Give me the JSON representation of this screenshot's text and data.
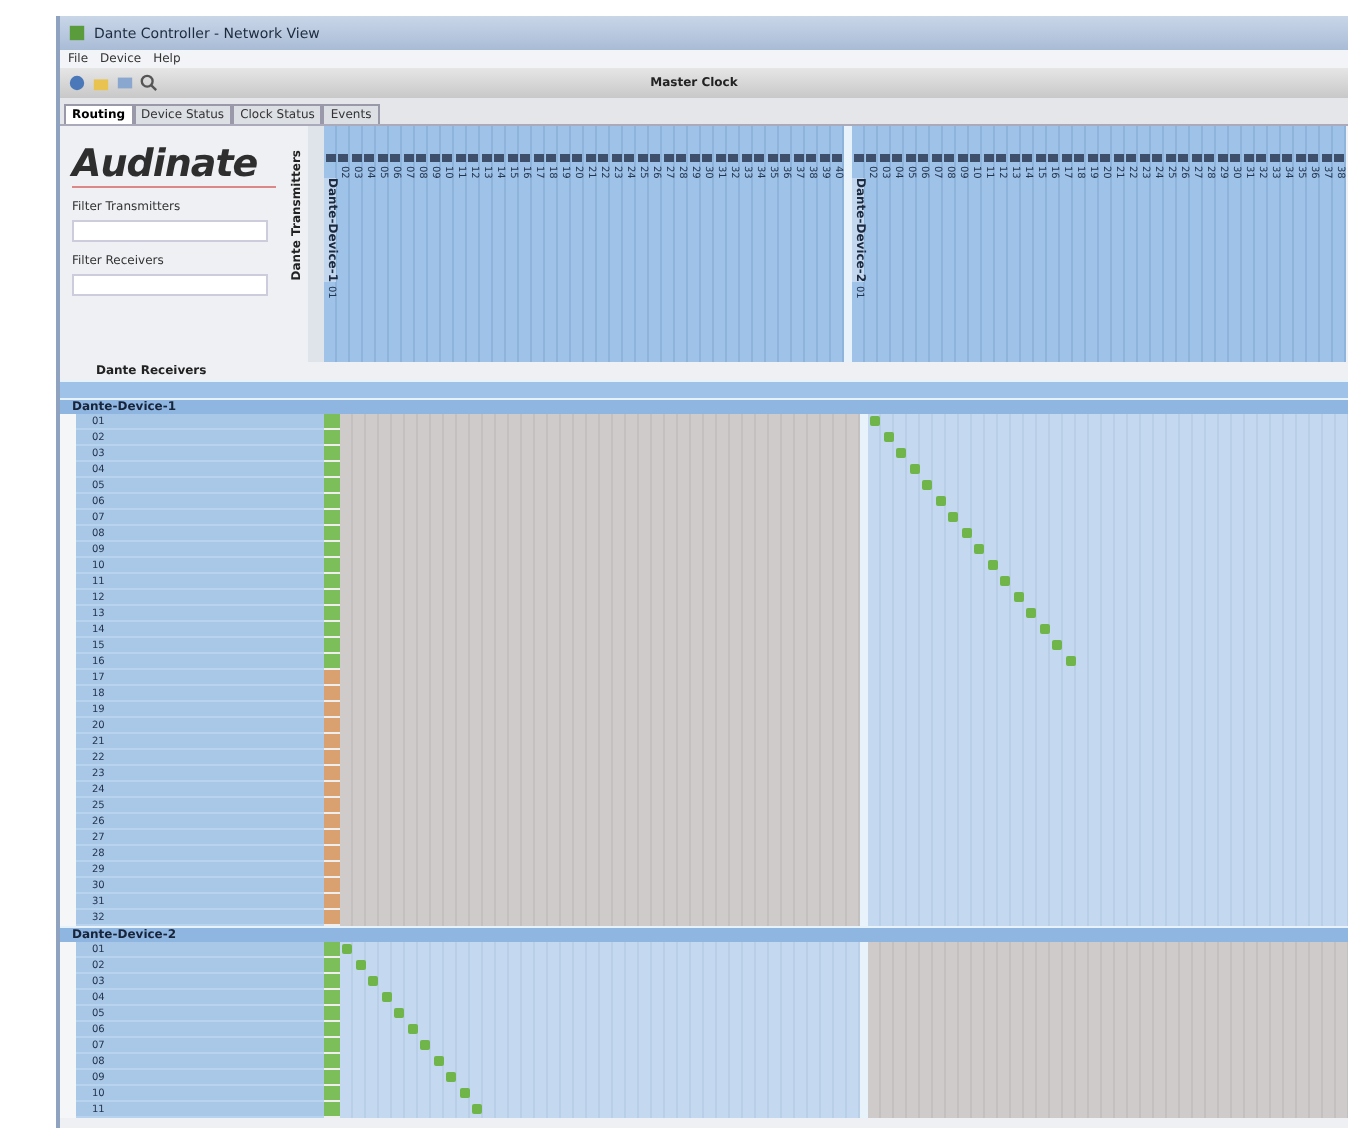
{
  "window": {
    "title": "Dante Controller - Network View"
  },
  "menu": [
    "File",
    "Device",
    "Help"
  ],
  "toolbar": {
    "status": "Master Clock"
  },
  "tabs": [
    {
      "label": "Routing",
      "selected": true
    },
    {
      "label": "Device Status",
      "selected": false
    },
    {
      "label": "Clock Status",
      "selected": false
    },
    {
      "label": "Events",
      "selected": false
    }
  ],
  "sidebar": {
    "logo": "Audinate",
    "filters": [
      {
        "label": "Filter Transmitters"
      },
      {
        "label": "Filter Receivers"
      }
    ],
    "transmitters_label": "Dante Transmitters",
    "receivers_label": "Dante Receivers"
  },
  "transmitters": [
    {
      "name": "Dante-Device-1",
      "channels": [
        "01",
        "02",
        "03",
        "04",
        "05",
        "06",
        "07",
        "08",
        "09",
        "10",
        "11",
        "12",
        "13",
        "14",
        "15",
        "16",
        "17",
        "18",
        "19",
        "20",
        "21",
        "22",
        "23",
        "24",
        "25",
        "26",
        "27",
        "28",
        "29",
        "30",
        "31",
        "32",
        "33",
        "34",
        "35",
        "36",
        "37",
        "38",
        "39",
        "40"
      ]
    },
    {
      "name": "Dante-Device-2",
      "channels": [
        "01",
        "02",
        "03",
        "04",
        "05",
        "06",
        "07",
        "08",
        "09",
        "10",
        "11",
        "12",
        "13",
        "14",
        "15",
        "16",
        "17",
        "18",
        "19",
        "20",
        "21",
        "22",
        "23",
        "24",
        "25",
        "26",
        "27",
        "28",
        "29",
        "30",
        "31",
        "32",
        "33",
        "34",
        "35",
        "36",
        "37",
        "38"
      ]
    }
  ],
  "receivers": [
    {
      "name": "Dante-Device-1",
      "channels": [
        {
          "label": "01",
          "subscribed": true
        },
        {
          "label": "02",
          "subscribed": true
        },
        {
          "label": "03",
          "subscribed": true
        },
        {
          "label": "04",
          "subscribed": true
        },
        {
          "label": "05",
          "subscribed": true
        },
        {
          "label": "06",
          "subscribed": true
        },
        {
          "label": "07",
          "subscribed": true
        },
        {
          "label": "08",
          "subscribed": true
        },
        {
          "label": "09",
          "subscribed": true
        },
        {
          "label": "10",
          "subscribed": true
        },
        {
          "label": "11",
          "subscribed": true
        },
        {
          "label": "12",
          "subscribed": true
        },
        {
          "label": "13",
          "subscribed": true
        },
        {
          "label": "14",
          "subscribed": true
        },
        {
          "label": "15",
          "subscribed": true
        },
        {
          "label": "16",
          "subscribed": true
        },
        {
          "label": "17",
          "subscribed": false
        },
        {
          "label": "18",
          "subscribed": false
        },
        {
          "label": "19",
          "subscribed": false
        },
        {
          "label": "20",
          "subscribed": false
        },
        {
          "label": "21",
          "subscribed": false
        },
        {
          "label": "22",
          "subscribed": false
        },
        {
          "label": "23",
          "subscribed": false
        },
        {
          "label": "24",
          "subscribed": false
        },
        {
          "label": "25",
          "subscribed": false
        },
        {
          "label": "26",
          "subscribed": false
        },
        {
          "label": "27",
          "subscribed": false
        },
        {
          "label": "28",
          "subscribed": false
        },
        {
          "label": "29",
          "subscribed": false
        },
        {
          "label": "30",
          "subscribed": false
        },
        {
          "label": "31",
          "subscribed": false
        },
        {
          "label": "32",
          "subscribed": false
        }
      ]
    },
    {
      "name": "Dante-Device-2",
      "channels": [
        {
          "label": "01",
          "subscribed": true
        },
        {
          "label": "02",
          "subscribed": true
        },
        {
          "label": "03",
          "subscribed": true
        },
        {
          "label": "04",
          "subscribed": true
        },
        {
          "label": "05",
          "subscribed": true
        },
        {
          "label": "06",
          "subscribed": true
        },
        {
          "label": "07",
          "subscribed": true
        },
        {
          "label": "08",
          "subscribed": true
        },
        {
          "label": "09",
          "subscribed": true
        },
        {
          "label": "10",
          "subscribed": true
        },
        {
          "label": "11",
          "subscribed": true
        }
      ]
    }
  ]
}
